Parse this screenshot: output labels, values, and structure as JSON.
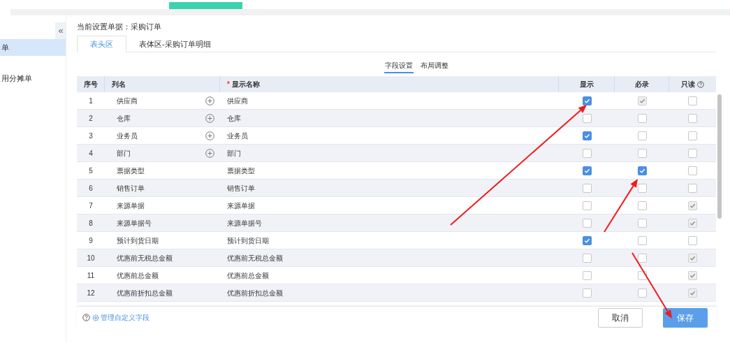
{
  "sidebar": {
    "collapse_icon": "«",
    "items": [
      {
        "label": "单",
        "selected": true
      },
      {
        "label": "用分摊单",
        "selected": false
      }
    ]
  },
  "header": {
    "current_doc": "当前设置单据：采购订单"
  },
  "tabs": [
    {
      "label": "表头区",
      "selected": true
    },
    {
      "label": "表体区-采购订单明细",
      "selected": false
    }
  ],
  "subtabs": [
    {
      "label": "字段设置",
      "selected": true
    },
    {
      "label": "布局调整",
      "selected": false
    }
  ],
  "table": {
    "columns": [
      "序号",
      "列名",
      "显示名称",
      "显示",
      "必录",
      "只读"
    ],
    "required_mark": "*",
    "rows": [
      {
        "index": "1",
        "column": "供应商",
        "addable": true,
        "display_name": "供应商",
        "show": {
          "checked": true,
          "disabled": false
        },
        "required": {
          "checked": true,
          "disabled": true
        },
        "readonly": {
          "checked": false,
          "disabled": false
        }
      },
      {
        "index": "2",
        "column": "仓库",
        "addable": true,
        "display_name": "仓库",
        "show": {
          "checked": false,
          "disabled": false
        },
        "required": {
          "checked": false,
          "disabled": false
        },
        "readonly": {
          "checked": false,
          "disabled": false
        }
      },
      {
        "index": "3",
        "column": "业务员",
        "addable": true,
        "display_name": "业务员",
        "show": {
          "checked": true,
          "disabled": false
        },
        "required": {
          "checked": false,
          "disabled": false
        },
        "readonly": {
          "checked": false,
          "disabled": false
        }
      },
      {
        "index": "4",
        "column": "部门",
        "addable": true,
        "display_name": "部门",
        "show": {
          "checked": false,
          "disabled": false
        },
        "required": {
          "checked": false,
          "disabled": false
        },
        "readonly": {
          "checked": false,
          "disabled": false
        }
      },
      {
        "index": "5",
        "column": "票据类型",
        "addable": false,
        "display_name": "票据类型",
        "show": {
          "checked": true,
          "disabled": false
        },
        "required": {
          "checked": true,
          "disabled": false
        },
        "readonly": {
          "checked": false,
          "disabled": false
        }
      },
      {
        "index": "6",
        "column": "销售订单",
        "addable": false,
        "display_name": "销售订单",
        "show": {
          "checked": false,
          "disabled": false
        },
        "required": {
          "checked": false,
          "disabled": false
        },
        "readonly": {
          "checked": false,
          "disabled": false
        }
      },
      {
        "index": "7",
        "column": "来源单据",
        "addable": false,
        "display_name": "来源单据",
        "show": {
          "checked": false,
          "disabled": false
        },
        "required": {
          "checked": false,
          "disabled": false
        },
        "readonly": {
          "checked": true,
          "disabled": true
        }
      },
      {
        "index": "8",
        "column": "来源单据号",
        "addable": false,
        "display_name": "来源单据号",
        "show": {
          "checked": false,
          "disabled": false
        },
        "required": {
          "checked": false,
          "disabled": false
        },
        "readonly": {
          "checked": true,
          "disabled": true
        }
      },
      {
        "index": "9",
        "column": "预计到货日期",
        "addable": false,
        "display_name": "预计到货日期",
        "show": {
          "checked": true,
          "disabled": false
        },
        "required": {
          "checked": false,
          "disabled": false
        },
        "readonly": {
          "checked": false,
          "disabled": false
        }
      },
      {
        "index": "10",
        "column": "优惠前无税总金额",
        "addable": false,
        "display_name": "优惠前无税总金额",
        "show": {
          "checked": false,
          "disabled": false
        },
        "required": {
          "checked": false,
          "disabled": false
        },
        "readonly": {
          "checked": true,
          "disabled": true
        }
      },
      {
        "index": "11",
        "column": "优惠前总金额",
        "addable": false,
        "display_name": "优惠前总金额",
        "show": {
          "checked": false,
          "disabled": false
        },
        "required": {
          "checked": false,
          "disabled": false
        },
        "readonly": {
          "checked": true,
          "disabled": true
        }
      },
      {
        "index": "12",
        "column": "优惠前折扣总金额",
        "addable": false,
        "display_name": "优惠前折扣总金额",
        "show": {
          "checked": false,
          "disabled": false
        },
        "required": {
          "checked": false,
          "disabled": false
        },
        "readonly": {
          "checked": true,
          "disabled": true
        }
      }
    ]
  },
  "footer": {
    "manage_link": "管理自定义字段",
    "buttons": [
      {
        "label": "取消",
        "kind": "secondary"
      },
      {
        "label": "保存",
        "kind": "primary"
      }
    ]
  }
}
